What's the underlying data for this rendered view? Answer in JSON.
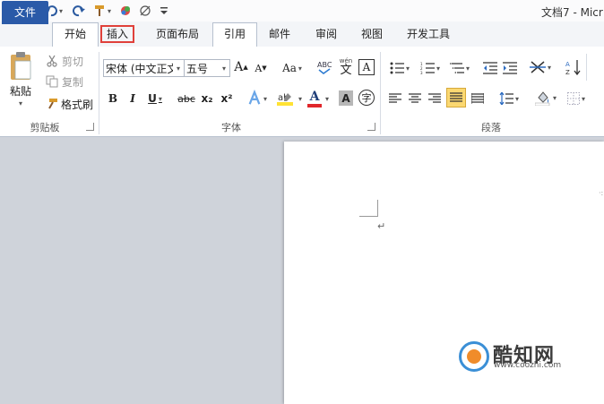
{
  "titlebar": {
    "app_icon": "W",
    "doc_title": "文档7 - Micr",
    "quick_access": [
      "save-icon",
      "undo-icon",
      "redo-icon",
      "format-painter-icon",
      "color-icon",
      "draw-icon",
      "customize-icon"
    ]
  },
  "tabs": {
    "file": "文件",
    "home": "开始",
    "insert": "插入",
    "page_layout": "页面布局",
    "references": "引用",
    "mailings": "邮件",
    "review": "审阅",
    "view": "视图",
    "developer": "开发工具"
  },
  "clipboard": {
    "paste": "粘贴",
    "cut": "剪切",
    "copy": "复制",
    "format_painter": "格式刷",
    "group_label": "剪贴板"
  },
  "font": {
    "font_name": "宋体 (中文正文",
    "font_size": "五号",
    "grow": "A",
    "shrink": "A",
    "change_case": "Aa",
    "bold": "B",
    "italic": "I",
    "underline": "U",
    "strikethrough": "abc",
    "subscript": "x₂",
    "superscript": "x²",
    "font_color": "A",
    "char_shading": "A",
    "enclose": "字",
    "phonetic": "文",
    "border": "A",
    "group_label": "字体"
  },
  "paragraph": {
    "group_label": "段落"
  },
  "watermark": {
    "name": "酷知网",
    "url": "www.coozhi.com"
  },
  "colors": {
    "file_tab": "#2a5aa8",
    "highlight_box": "#e0403a",
    "font_color_bar": "#e0262b",
    "highlight_color_bar": "#ffe233",
    "selected_align": "#fbd871"
  }
}
